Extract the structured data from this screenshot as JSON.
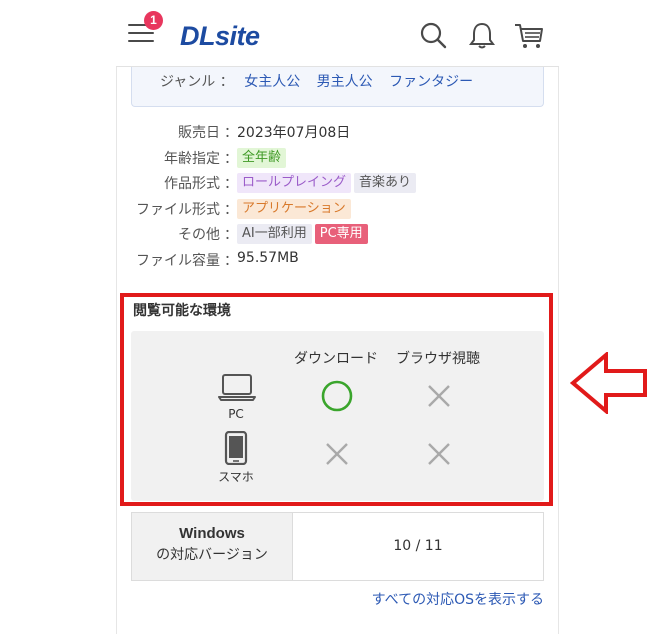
{
  "header": {
    "logo": "DLsite",
    "notification_badge": "1",
    "icons": [
      "menu-icon",
      "search-icon",
      "bell-icon",
      "cart-icon"
    ]
  },
  "genre": {
    "label": "ジャンル",
    "colon": "：",
    "links": [
      "女主人公",
      "男主人公",
      "ファンタジー"
    ]
  },
  "spec": {
    "colon": "：",
    "release_label": "販売日",
    "release_value": "2023年07月08日",
    "age_label": "年齢指定",
    "age_tag": "全年齢",
    "format_label": "作品形式",
    "format_tags": [
      "ロールプレイング",
      "音楽あり"
    ],
    "file_label": "ファイル形式",
    "file_tag": "アプリケーション",
    "other_label": "その他",
    "other_tags": [
      "AI一部利用",
      "PC専用"
    ],
    "size_label": "ファイル容量",
    "size_value": "95.57MB"
  },
  "environment": {
    "title": "閲覧可能な環境",
    "col_download": "ダウンロード",
    "col_browser": "ブラウザ視聴",
    "rows": [
      {
        "device": "PC",
        "icon": "laptop-icon",
        "download": "available",
        "browser": "unavailable"
      },
      {
        "device": "スマホ",
        "icon": "smartphone-icon",
        "download": "unavailable",
        "browser": "unavailable"
      }
    ]
  },
  "os": {
    "head_line1": "Windows",
    "head_line2": "の対応バージョン",
    "value": "10 / 11",
    "show_all": "すべての対応OSを表示する"
  },
  "colors": {
    "brand": "#1d4ba1",
    "link": "#2c59b4",
    "highlight_frame": "#e11a1a",
    "ok_circle": "#3aa52c",
    "ng_cross": "#a9a9a9"
  }
}
